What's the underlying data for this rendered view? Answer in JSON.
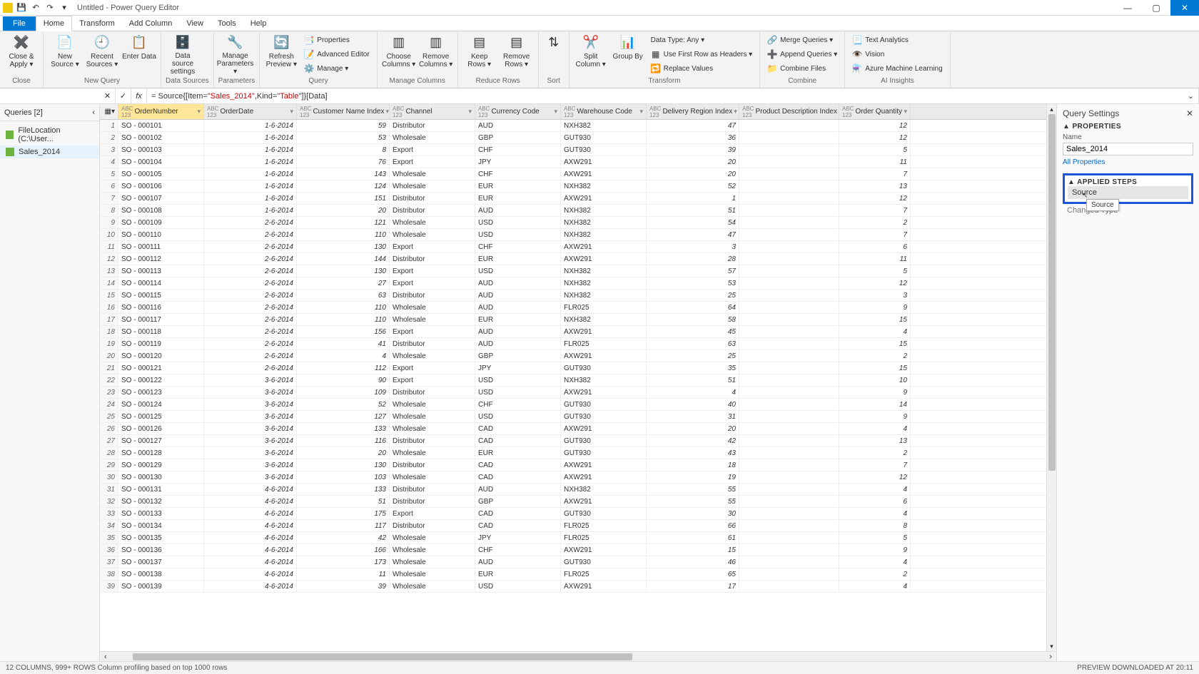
{
  "window_title": "Untitled - Power Query Editor",
  "tabs": {
    "file": "File",
    "home": "Home",
    "transform": "Transform",
    "add_column": "Add Column",
    "view": "View",
    "tools": "Tools",
    "help": "Help"
  },
  "ribbon": {
    "close_apply": "Close &\nApply ▾",
    "new_source": "New\nSource ▾",
    "recent_sources": "Recent\nSources ▾",
    "enter_data": "Enter\nData",
    "data_source": "Data source\nsettings",
    "manage_params": "Manage\nParameters ▾",
    "refresh": "Refresh\nPreview ▾",
    "properties": "Properties",
    "adv_editor": "Advanced Editor",
    "manage": "Manage ▾",
    "choose_cols": "Choose\nColumns ▾",
    "remove_cols": "Remove\nColumns ▾",
    "keep_rows": "Keep\nRows ▾",
    "remove_rows": "Remove\nRows ▾",
    "sort": "⇵",
    "split_col": "Split\nColumn ▾",
    "group_by": "Group\nBy",
    "data_type": "Data Type: Any ▾",
    "first_row": "Use First Row as Headers ▾",
    "replace": "Replace Values",
    "merge": "Merge Queries ▾",
    "append": "Append Queries ▾",
    "combine_files": "Combine Files",
    "text_an": "Text Analytics",
    "vision": "Vision",
    "azure_ml": "Azure Machine Learning",
    "groups": {
      "close": "Close",
      "new_query": "New Query",
      "data_sources": "Data Sources",
      "params": "Parameters",
      "query": "Query",
      "manage_cols": "Manage Columns",
      "reduce_rows": "Reduce Rows",
      "sort": "Sort",
      "transform": "Transform",
      "combine": "Combine",
      "ai": "AI Insights"
    }
  },
  "formula": {
    "prefix": "= Source{[Item=",
    "str": "\"Sales_2014\"",
    "mid": ",Kind=",
    "str2": "\"Table\"",
    "suffix": "]}[Data]"
  },
  "queries_pane": {
    "title": "Queries [2]",
    "items": [
      {
        "label": "FileLocation (C:\\User..."
      },
      {
        "label": "Sales_2014",
        "selected": true
      }
    ]
  },
  "settings": {
    "title": "Query Settings",
    "properties": "PROPERTIES",
    "name_label": "Name",
    "name_value": "Sales_2014",
    "all_props": "All Properties",
    "applied": "APPLIED STEPS",
    "step_source": "Source",
    "step_change": "Changed Type",
    "tooltip": "Source"
  },
  "columns": [
    "OrderNumber",
    "OrderDate",
    "Customer Name Index",
    "Channel",
    "Currency Code",
    "Warehouse Code",
    "Delivery Region Index",
    "Product Description Index",
    "Order Quantity"
  ],
  "rows": [
    [
      "SO - 000101",
      "1-6-2014",
      "59",
      "Distributor",
      "AUD",
      "NXH382",
      "47",
      "",
      "12"
    ],
    [
      "SO - 000102",
      "1-6-2014",
      "53",
      "Wholesale",
      "GBP",
      "GUT930",
      "36",
      "",
      "12"
    ],
    [
      "SO - 000103",
      "1-6-2014",
      "8",
      "Export",
      "CHF",
      "GUT930",
      "39",
      "",
      "5"
    ],
    [
      "SO - 000104",
      "1-6-2014",
      "76",
      "Export",
      "JPY",
      "AXW291",
      "20",
      "",
      "11"
    ],
    [
      "SO - 000105",
      "1-6-2014",
      "143",
      "Wholesale",
      "CHF",
      "AXW291",
      "20",
      "",
      "7"
    ],
    [
      "SO - 000106",
      "1-6-2014",
      "124",
      "Wholesale",
      "EUR",
      "NXH382",
      "52",
      "",
      "13"
    ],
    [
      "SO - 000107",
      "1-6-2014",
      "151",
      "Distributor",
      "EUR",
      "AXW291",
      "1",
      "",
      "12"
    ],
    [
      "SO - 000108",
      "1-6-2014",
      "20",
      "Distributor",
      "AUD",
      "NXH382",
      "51",
      "",
      "7"
    ],
    [
      "SO - 000109",
      "2-6-2014",
      "121",
      "Wholesale",
      "USD",
      "NXH382",
      "54",
      "",
      "2"
    ],
    [
      "SO - 000110",
      "2-6-2014",
      "110",
      "Wholesale",
      "USD",
      "NXH382",
      "47",
      "",
      "7"
    ],
    [
      "SO - 000111",
      "2-6-2014",
      "130",
      "Export",
      "CHF",
      "AXW291",
      "3",
      "",
      "6"
    ],
    [
      "SO - 000112",
      "2-6-2014",
      "144",
      "Distributor",
      "EUR",
      "AXW291",
      "28",
      "",
      "11"
    ],
    [
      "SO - 000113",
      "2-6-2014",
      "130",
      "Export",
      "USD",
      "NXH382",
      "57",
      "",
      "5"
    ],
    [
      "SO - 000114",
      "2-6-2014",
      "27",
      "Export",
      "AUD",
      "NXH382",
      "53",
      "",
      "12"
    ],
    [
      "SO - 000115",
      "2-6-2014",
      "63",
      "Distributor",
      "AUD",
      "NXH382",
      "25",
      "",
      "3"
    ],
    [
      "SO - 000116",
      "2-6-2014",
      "110",
      "Wholesale",
      "AUD",
      "FLR025",
      "64",
      "",
      "9"
    ],
    [
      "SO - 000117",
      "2-6-2014",
      "110",
      "Wholesale",
      "EUR",
      "NXH382",
      "58",
      "",
      "15"
    ],
    [
      "SO - 000118",
      "2-6-2014",
      "156",
      "Export",
      "AUD",
      "AXW291",
      "45",
      "",
      "4"
    ],
    [
      "SO - 000119",
      "2-6-2014",
      "41",
      "Distributor",
      "AUD",
      "FLR025",
      "63",
      "",
      "15"
    ],
    [
      "SO - 000120",
      "2-6-2014",
      "4",
      "Wholesale",
      "GBP",
      "AXW291",
      "25",
      "",
      "2"
    ],
    [
      "SO - 000121",
      "2-6-2014",
      "112",
      "Export",
      "JPY",
      "GUT930",
      "35",
      "",
      "15"
    ],
    [
      "SO - 000122",
      "3-6-2014",
      "90",
      "Export",
      "USD",
      "NXH382",
      "51",
      "",
      "10"
    ],
    [
      "SO - 000123",
      "3-6-2014",
      "109",
      "Distributor",
      "USD",
      "AXW291",
      "4",
      "",
      "9"
    ],
    [
      "SO - 000124",
      "3-6-2014",
      "52",
      "Wholesale",
      "CHF",
      "GUT930",
      "40",
      "",
      "14"
    ],
    [
      "SO - 000125",
      "3-6-2014",
      "127",
      "Wholesale",
      "USD",
      "GUT930",
      "31",
      "",
      "9"
    ],
    [
      "SO - 000126",
      "3-6-2014",
      "133",
      "Wholesale",
      "CAD",
      "AXW291",
      "20",
      "",
      "4"
    ],
    [
      "SO - 000127",
      "3-6-2014",
      "116",
      "Distributor",
      "CAD",
      "GUT930",
      "42",
      "",
      "13"
    ],
    [
      "SO - 000128",
      "3-6-2014",
      "20",
      "Wholesale",
      "EUR",
      "GUT930",
      "43",
      "",
      "2"
    ],
    [
      "SO - 000129",
      "3-6-2014",
      "130",
      "Distributor",
      "CAD",
      "AXW291",
      "18",
      "",
      "7"
    ],
    [
      "SO - 000130",
      "3-6-2014",
      "103",
      "Wholesale",
      "CAD",
      "AXW291",
      "19",
      "",
      "12"
    ],
    [
      "SO - 000131",
      "4-6-2014",
      "133",
      "Distributor",
      "AUD",
      "NXH382",
      "55",
      "",
      "4"
    ],
    [
      "SO - 000132",
      "4-6-2014",
      "51",
      "Distributor",
      "GBP",
      "AXW291",
      "55",
      "",
      "6"
    ],
    [
      "SO - 000133",
      "4-6-2014",
      "175",
      "Export",
      "CAD",
      "GUT930",
      "30",
      "",
      "4"
    ],
    [
      "SO - 000134",
      "4-6-2014",
      "117",
      "Distributor",
      "CAD",
      "FLR025",
      "66",
      "",
      "8"
    ],
    [
      "SO - 000135",
      "4-6-2014",
      "42",
      "Wholesale",
      "JPY",
      "FLR025",
      "61",
      "",
      "5"
    ],
    [
      "SO - 000136",
      "4-6-2014",
      "166",
      "Wholesale",
      "CHF",
      "AXW291",
      "15",
      "",
      "9"
    ],
    [
      "SO - 000137",
      "4-6-2014",
      "173",
      "Wholesale",
      "AUD",
      "GUT930",
      "46",
      "",
      "4"
    ],
    [
      "SO - 000138",
      "4-6-2014",
      "11",
      "Wholesale",
      "EUR",
      "FLR025",
      "65",
      "",
      "2"
    ],
    [
      "SO - 000139",
      "4-6-2014",
      "39",
      "Wholesale",
      "USD",
      "AXW291",
      "17",
      "",
      "4"
    ]
  ],
  "status": {
    "left": "12 COLUMNS, 999+ ROWS    Column profiling based on top 1000 rows",
    "right": "PREVIEW DOWNLOADED AT 20:11"
  }
}
